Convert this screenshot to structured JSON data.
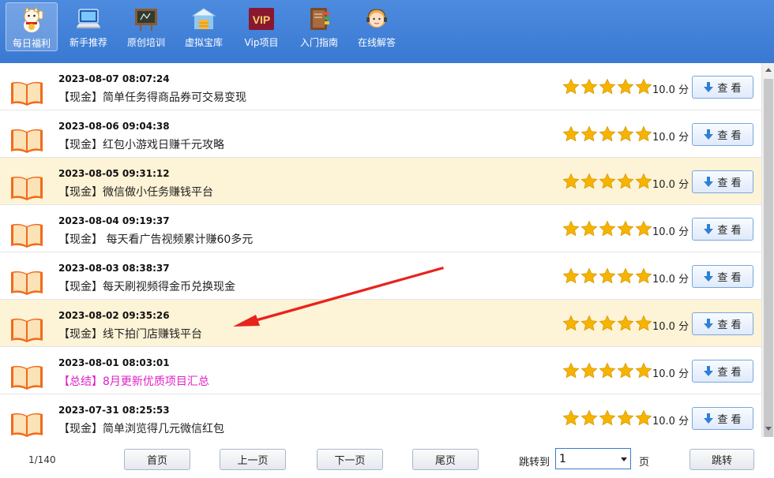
{
  "toolbar": {
    "items": [
      {
        "label": "每日福利",
        "icon": "lucky-cat-icon",
        "active": true
      },
      {
        "label": "新手推荐",
        "icon": "laptop-icon"
      },
      {
        "label": "原创培训",
        "icon": "chalkboard-icon"
      },
      {
        "label": "虚拟宝库",
        "icon": "warehouse-icon"
      },
      {
        "label": "Vip项目",
        "icon": "vip-badge-icon",
        "badge": "VIP"
      },
      {
        "label": "入门指南",
        "icon": "guide-book-icon"
      },
      {
        "label": "在线解答",
        "icon": "support-agent-icon"
      }
    ]
  },
  "list": {
    "rows": [
      {
        "date": "2023-08-07 08:07:24",
        "title": "【现金】简单任务得商品券可交易变现",
        "score": "10.0 分",
        "button": "查 看",
        "rating": 5
      },
      {
        "date": "2023-08-06 09:04:38",
        "title": "【现金】红包小游戏日赚千元攻略",
        "score": "10.0 分",
        "button": "查 看",
        "rating": 5
      },
      {
        "date": "2023-08-05 09:31:12",
        "title": "【现金】微信做小任务赚钱平台",
        "score": "10.0 分",
        "button": "查 看",
        "rating": 5
      },
      {
        "date": "2023-08-04 09:19:37",
        "title": "【现金】 每天看广告视频累计赚60多元",
        "score": "10.0 分",
        "button": "查 看",
        "rating": 5
      },
      {
        "date": "2023-08-03 08:38:37",
        "title": "【现金】每天刷视频得金币兑换现金",
        "score": "10.0 分",
        "button": "查 看",
        "rating": 5
      },
      {
        "date": "2023-08-02 09:35:26",
        "title": "【现金】线下拍门店赚钱平台",
        "score": "10.0 分",
        "button": "查 看",
        "rating": 5
      },
      {
        "date": "2023-08-01 08:03:01",
        "title": "【总结】8月更新优质项目汇总",
        "score": "10.0 分",
        "button": "查 看",
        "rating": 5
      },
      {
        "date": "2023-07-31 08:25:53",
        "title": "【现金】简单浏览得几元微信红包",
        "score": "10.0 分",
        "button": "查 看",
        "rating": 5
      }
    ]
  },
  "footer": {
    "page_info": "1/140",
    "first": "首页",
    "prev": "上一页",
    "next": "下一页",
    "last": "尾页",
    "jump_label": "跳转到",
    "page_value": "1",
    "page_unit": "页",
    "jump_button": "跳转"
  },
  "colors": {
    "toolbar": "#3a79d2",
    "highlight_row": "#fdf3d6",
    "star": "#f5b400",
    "summary_title": "#e020c8",
    "annotation_arrow": "#e8231c"
  }
}
